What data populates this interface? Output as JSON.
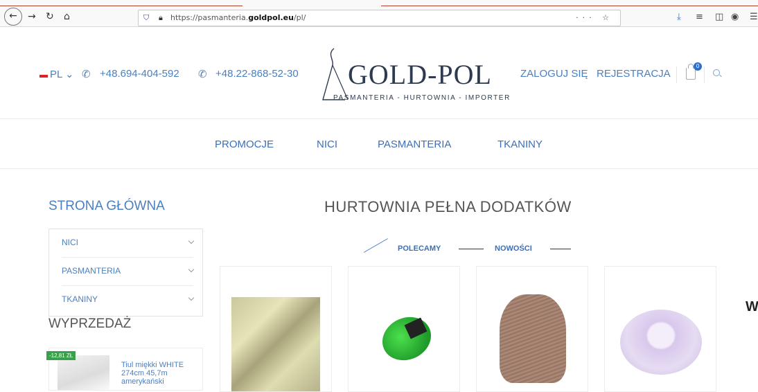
{
  "browser": {
    "url_prefix": "https://pasmanteria.",
    "url_domain": "goldpol.eu",
    "url_suffix": "/pl/",
    "url_actions": "··· ☆"
  },
  "header": {
    "language": "PL",
    "phone1": "+48.694-404-592",
    "phone2": "+48.22-868-52-30",
    "logo_name": "GOLD-POL",
    "logo_tagline": "PASMANTERIA - HURTOWNIA - IMPORTER",
    "login_label": "ZALOGUJ SIĘ",
    "register_label": "REJESTRACJA",
    "cart_count": "0"
  },
  "menu": {
    "items": [
      "PROMOCJE",
      "NICI",
      "PASMANTERIA",
      "TKANINY"
    ]
  },
  "sidebar": {
    "home_label": "STRONA GŁÓWNA",
    "categories": [
      "NICI",
      "PASMANTERIA",
      "TKANINY"
    ],
    "sale_title": "WYPRZEDAŻ",
    "sale_item": {
      "badge": "-12,81 ZŁ",
      "name": "Tiul miękki WHITE 274cm 45,7m amerykański"
    }
  },
  "main": {
    "title": "HURTOWNIA PEŁNA DODATKÓW",
    "tabs": [
      "POLECAMY",
      "NOWOŚCI"
    ],
    "side_text": "W"
  },
  "colors": {
    "accent": "#3a6fb8",
    "badge_green": "#3aa04a",
    "flag_red": "#e0202a"
  }
}
